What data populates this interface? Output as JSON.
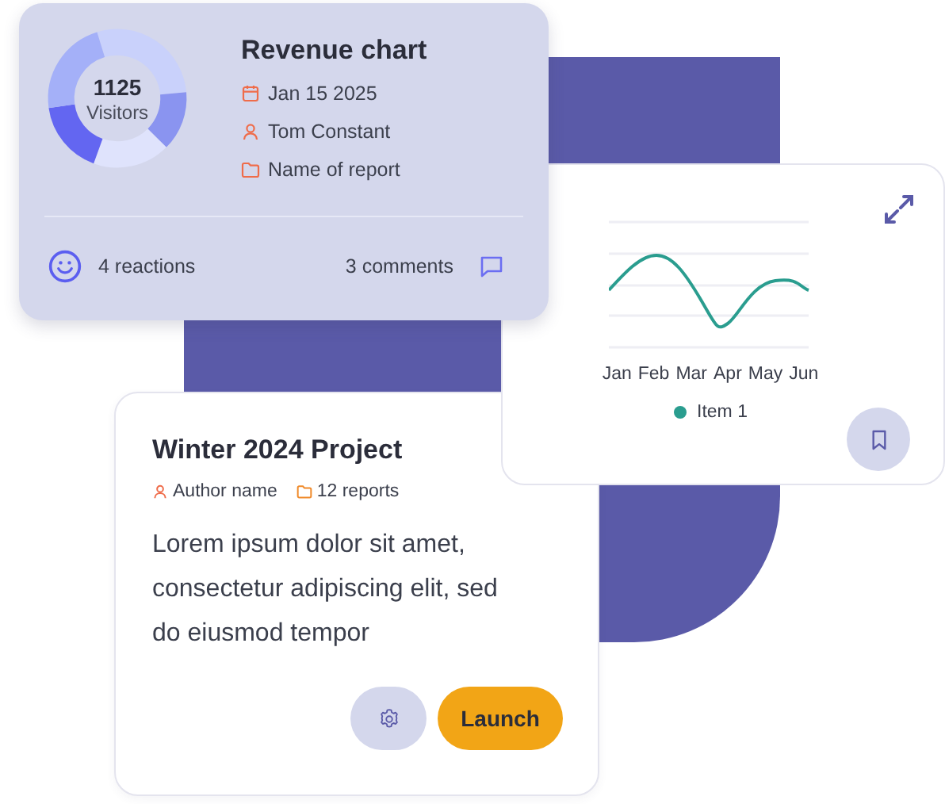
{
  "revenue_card": {
    "donut_total": "1125",
    "donut_label": "Visitors",
    "title": "Revenue chart",
    "meta": [
      {
        "kind": "date",
        "text": "Jan 15 2025"
      },
      {
        "kind": "person",
        "text": "Tom Constant"
      },
      {
        "kind": "folder",
        "text": "Name of report"
      }
    ],
    "reactions": "4 reactions",
    "comments": "3 comments"
  },
  "chart_card": {
    "x_labels": [
      "Jan",
      "Feb",
      "Mar",
      "Apr",
      "May",
      "Jun"
    ],
    "legend": {
      "label": "Item 1",
      "color": "#2a9d8f"
    }
  },
  "project_card": {
    "title": "Winter 2024 Project",
    "meta": [
      {
        "kind": "person",
        "text": "Author name"
      },
      {
        "kind": "folder",
        "text": "12 reports"
      }
    ],
    "body": "Lorem ipsum dolor sit amet, consectetur adipiscing elit, sed do eiusmod tempor",
    "action": "Launch"
  }
}
